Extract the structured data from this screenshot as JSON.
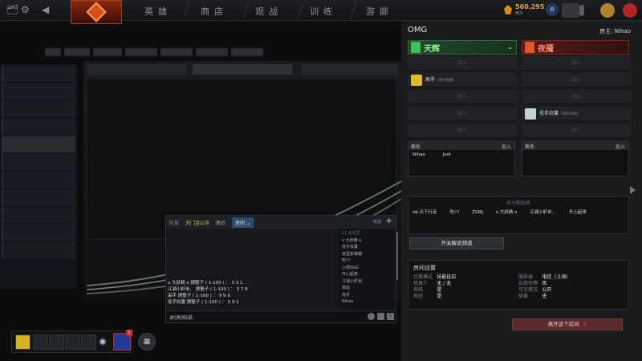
{
  "topbar": {
    "nav": [
      "英雄",
      "商店",
      "观战",
      "训练",
      "游廊"
    ],
    "gold": "560,295",
    "gold_sub": "精片",
    "level_badge": "0",
    "icons": [
      "notification-icon",
      "gear-icon",
      "back-arrow-icon",
      "dota-logo-icon",
      "gold-shard-icon",
      "level-badge-icon",
      "inventory-icon",
      "shield-icon",
      "power-icon"
    ]
  },
  "chat": {
    "tabs": [
      "队伍",
      "天门金山寺",
      "路后",
      "房间"
    ],
    "active_tab": "房间",
    "settings_label": "频道",
    "messages": [
      "o 大妖精 o 掷骰子 ( 1-100 ) ： 3 3 1",
      "江湖小虾米、 掷骰子 ( 1-100 ) ： 3 7 8",
      "高手 掷骰子 ( 1-100 ) ： 9 9 9",
      "低手纹蔓 掷骰子 ( 1-100 ) ： 0 9 2"
    ],
    "members_header": "11 名成员",
    "members": [
      "o 大妖精 o",
      "低手纹蔓",
      "克星影蟑螂",
      "吃!!!",
      "小郭SGG",
      "开心起来",
      "江湖小虾米、",
      "谱站",
      "高手",
      "Nihao"
    ],
    "input_prefix": "对(房间)说:"
  },
  "lobby": {
    "title": "OMG",
    "host_label": "房主:",
    "host_name": "Nihao",
    "radiant_name": "天辉",
    "dire_name": "夜魇",
    "empty_slot": "加入",
    "radiant_player": "高手",
    "radiant_player_tag": "[碧绿雅魔]",
    "dire_player": "低手纹蔓",
    "dire_player_tag": "[鹭眼龟蜗]",
    "coach_label": "教练",
    "coach_join": "加入",
    "radiant_coaches": [
      "Nihao",
      "Just"
    ],
    "unassigned_header": "未分配玩家",
    "unassigned": [
      "ob.天下行走",
      "吃!!!",
      "ZSMJ",
      "o 大妖精 o",
      "江湖小虾米、",
      "开心起来"
    ],
    "caster_button": "开关解说频道",
    "settings_header": "房间设置",
    "settings": [
      {
        "key": "比赛模式",
        "val": "技能征召",
        "key2": "服务器",
        "val2": "电信（上海）"
      },
      {
        "key": "机器人",
        "val": "无 / 无",
        "key2": "启用作弊",
        "val2": "否"
      },
      {
        "key": "密码",
        "val": "是",
        "key2": "可见情况",
        "val2": "公开"
      },
      {
        "key": "观战",
        "val": "是",
        "key2": "联赛",
        "val2": "无"
      }
    ],
    "leave_button": "离开这个房间"
  },
  "party": {
    "badge_count": "1"
  },
  "colors": {
    "radiant": "#9df0a2",
    "dire": "#ff8a6a",
    "gold": "#e7a437",
    "accent_chat": "#b9d43a"
  }
}
